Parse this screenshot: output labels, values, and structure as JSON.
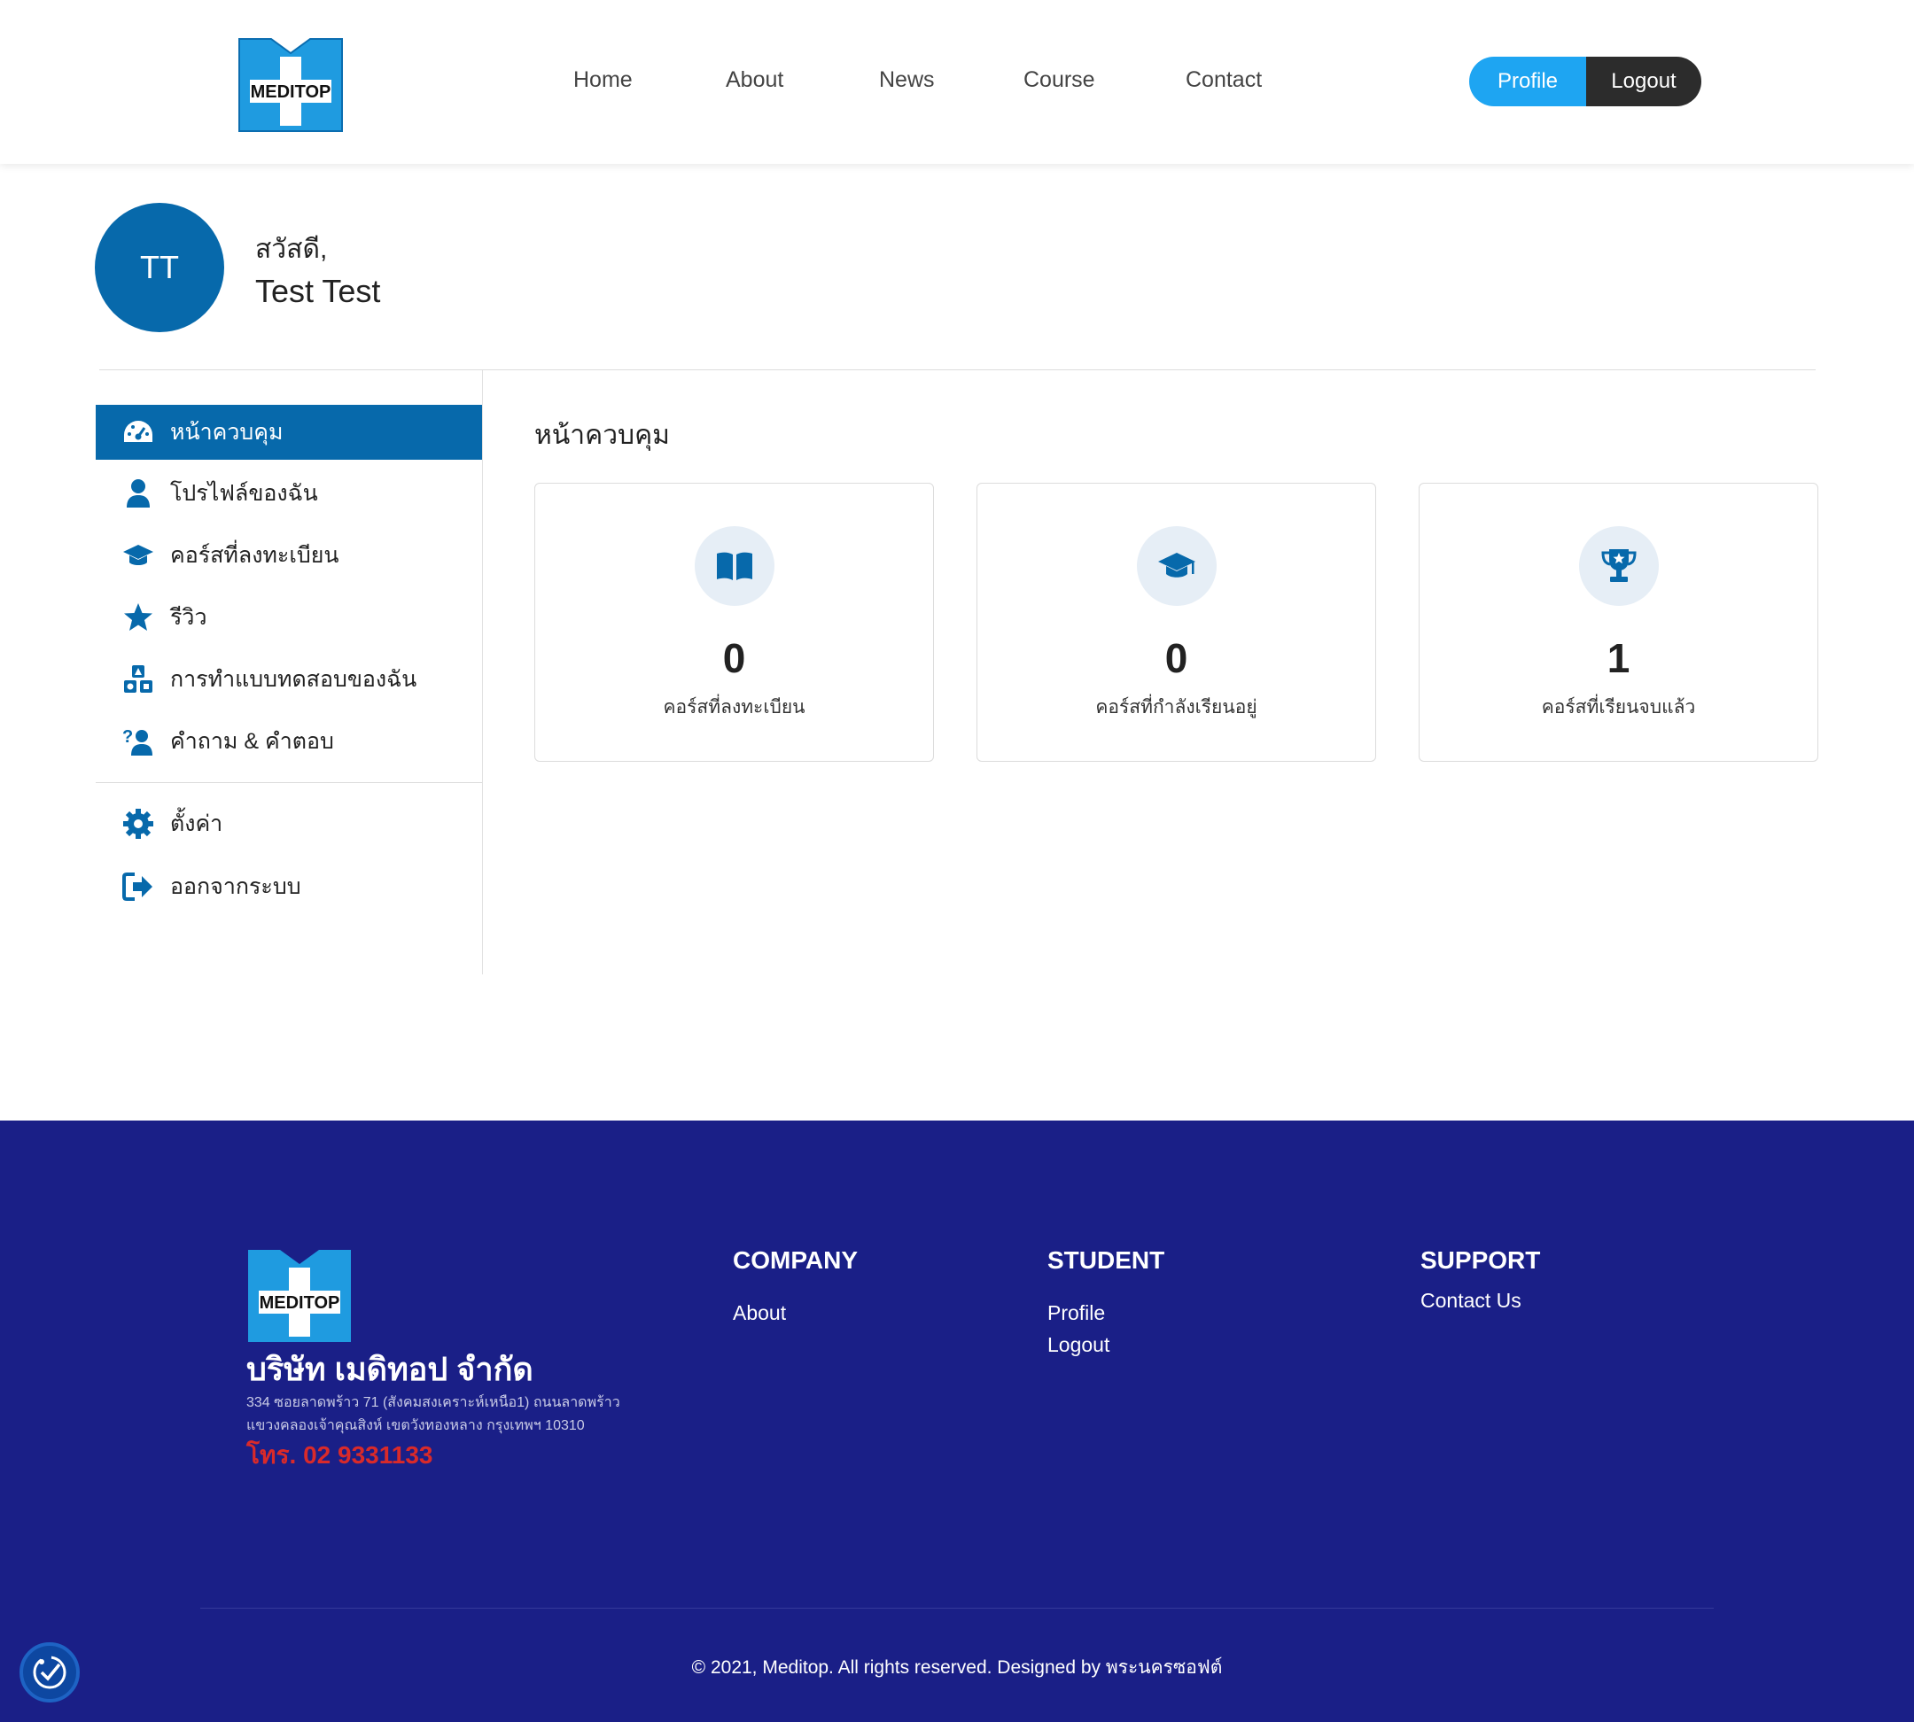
{
  "header": {
    "logo_text": "MEDITOP",
    "nav": [
      "Home",
      "About",
      "News",
      "Course",
      "Contact"
    ],
    "profile_label": "Profile",
    "logout_label": "Logout"
  },
  "user": {
    "initials": "TT",
    "greeting": "สวัสดี,",
    "name": "Test Test"
  },
  "sidebar": {
    "items": [
      {
        "label": "หน้าควบคุม",
        "icon": "dashboard-icon",
        "active": true
      },
      {
        "label": "โปรไฟล์ของฉัน",
        "icon": "user-icon"
      },
      {
        "label": "คอร์สที่ลงทะเบียน",
        "icon": "graduation-cap-icon"
      },
      {
        "label": "รีวิว",
        "icon": "star-icon"
      },
      {
        "label": "การทำแบบทดสอบของฉัน",
        "icon": "shapes-icon"
      },
      {
        "label": "คำถาม & คำตอบ",
        "icon": "question-user-icon"
      }
    ],
    "bottom_items": [
      {
        "label": "ตั้งค่า",
        "icon": "gear-icon"
      },
      {
        "label": "ออกจากระบบ",
        "icon": "sign-out-icon"
      }
    ]
  },
  "main": {
    "title": "หน้าควบคุม",
    "cards": [
      {
        "value": "0",
        "label": "คอร์สที่ลงทะเบียน",
        "icon": "book-open-icon"
      },
      {
        "value": "0",
        "label": "คอร์สที่กำลังเรียนอยู่",
        "icon": "graduation-cap-icon"
      },
      {
        "value": "1",
        "label": "คอร์สที่เรียนจบแล้ว",
        "icon": "trophy-icon"
      }
    ]
  },
  "footer": {
    "logo_text": "MEDITOP",
    "company_name": "บริษัท เมดิทอป จำกัด",
    "address_line1": "334 ซอยลาดพร้าว 71 (สังคมสงเคราะห์เหนือ1) ถนนลาดพร้าว",
    "address_line2": "แขวงคลองเจ้าคุณสิงห์ เขตวังทองหลาง กรุงเทพฯ 10310",
    "tel": "โทร. 02 9331133",
    "columns": [
      {
        "heading": "COMPANY",
        "links": [
          "About"
        ]
      },
      {
        "heading": "STUDENT",
        "links": [
          "Profile",
          "Logout"
        ]
      },
      {
        "heading": "SUPPORT",
        "links": [
          "Contact Us"
        ]
      }
    ],
    "copyright": "© 2021, Meditop. All rights reserved. Designed by พระนครซอฟต์"
  },
  "colors": {
    "primary": "#0769ab",
    "profile_button": "#1ea5f2",
    "logout_button": "#2c2c2c",
    "footer_bg": "#1a1f87",
    "tel_red": "#d92a2a"
  }
}
